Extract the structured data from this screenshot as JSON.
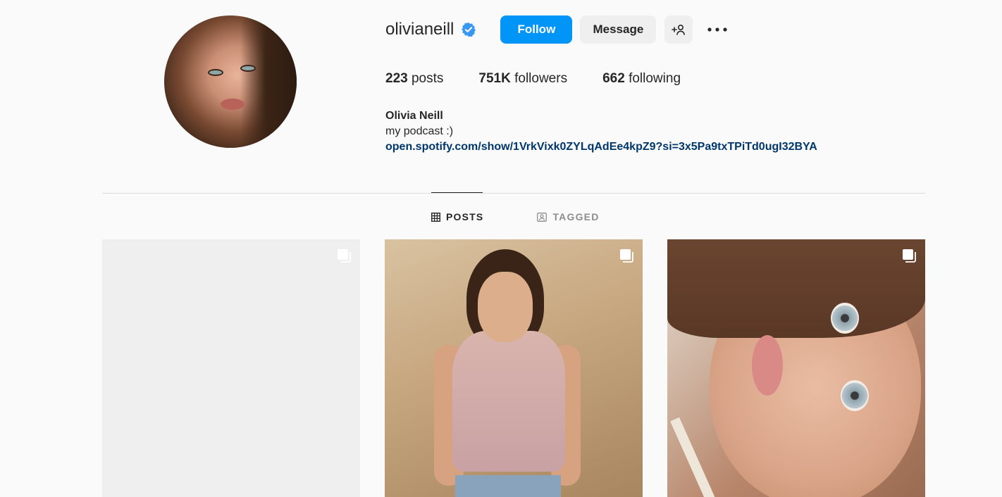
{
  "profile": {
    "username": "olivianeill",
    "verified": true,
    "follow_label": "Follow",
    "message_label": "Message",
    "stats": {
      "posts_count": "223",
      "posts_label": "posts",
      "followers_count": "751K",
      "followers_label": "followers",
      "following_count": "662",
      "following_label": "following"
    },
    "full_name": "Olivia Neill",
    "bio": "my podcast :)",
    "link": "open.spotify.com/show/1VrkVixk0ZYLqAdEe4kpZ9?si=3x5Pa9txTPiTd0ugI32BYA"
  },
  "tabs": [
    {
      "label": "POSTS",
      "active": true,
      "icon": "grid-icon"
    },
    {
      "label": "TAGGED",
      "active": false,
      "icon": "tagged-icon"
    }
  ],
  "colors": {
    "accent": "#0095f6",
    "link": "#00376b",
    "verified": "#3897f0"
  },
  "posts": [
    {
      "type": "carousel",
      "icon": "multiple-posts-icon"
    },
    {
      "type": "carousel",
      "icon": "multiple-posts-icon"
    },
    {
      "type": "carousel",
      "icon": "multiple-posts-icon"
    }
  ]
}
